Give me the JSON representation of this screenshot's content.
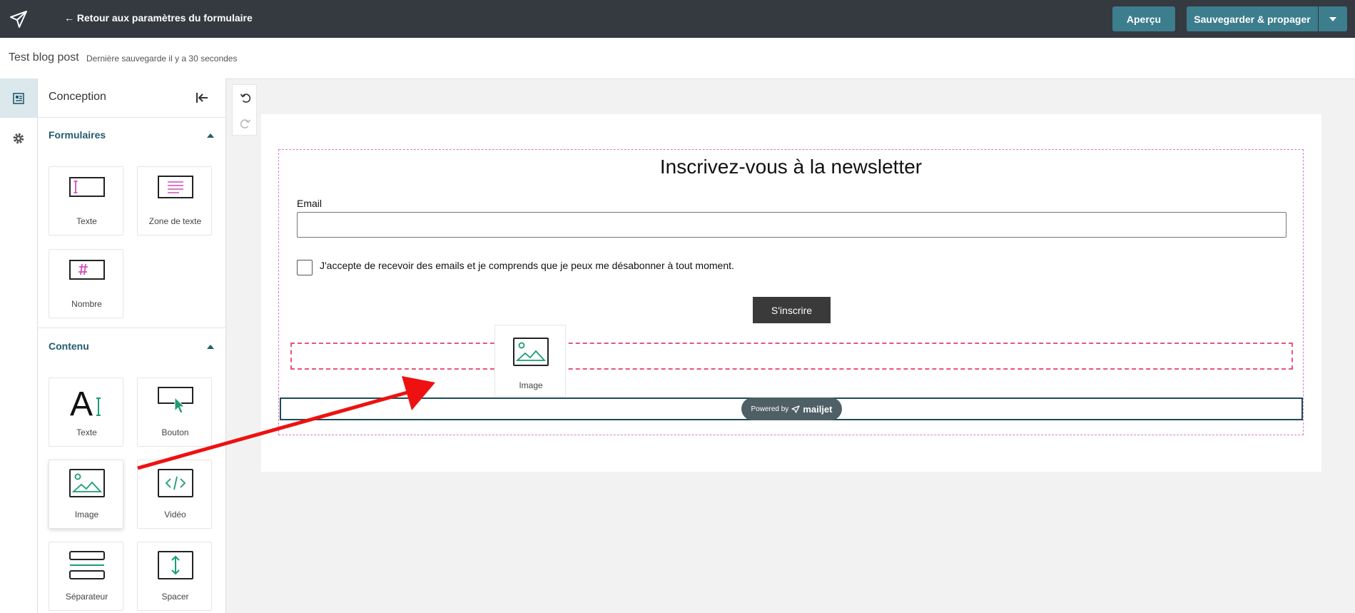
{
  "topbar": {
    "back_label": "← Retour aux paramètres du formulaire",
    "preview_label": "Aperçu",
    "save_label": "Sauvegarder & propager"
  },
  "titlebar": {
    "form_name": "Test blog post",
    "save_status": "Dernière sauvegarde il y a 30 secondes"
  },
  "panel": {
    "title": "Conception",
    "sections": [
      {
        "title": "Formulaires",
        "items": [
          {
            "label": "Texte",
            "icon": "text-field-icon"
          },
          {
            "label": "Zone de texte",
            "icon": "textarea-icon"
          },
          {
            "label": "Nombre",
            "icon": "number-field-icon"
          }
        ]
      },
      {
        "title": "Contenu",
        "items": [
          {
            "label": "Texte",
            "icon": "text-block-icon"
          },
          {
            "label": "Bouton",
            "icon": "button-block-icon"
          },
          {
            "label": "Image",
            "icon": "image-icon"
          },
          {
            "label": "Vidéo",
            "icon": "video-icon"
          },
          {
            "label": "Séparateur",
            "icon": "separator-icon"
          },
          {
            "label": "Spacer",
            "icon": "spacer-icon"
          }
        ]
      }
    ]
  },
  "form": {
    "heading": "Inscrivez-vous à la newsletter",
    "email_label": "Email",
    "email_value": "",
    "consent_text": "J'accepte de recevoir des emails et je comprends que je peux me désabonner à tout moment.",
    "consent_checked": false,
    "submit_label": "S'inscrire",
    "powered_by": "Powered by",
    "brand": "mailjet"
  },
  "drag_ghost": {
    "label": "Image",
    "icon": "image-icon"
  },
  "colors": {
    "topbar_bg": "#343a40",
    "primary_button": "#3c7d8e",
    "section_title": "#245b6e",
    "accent_pink": "#d24dbd",
    "accent_green": "#1b9e6e",
    "dropzone_border": "#e8557a",
    "annotation_arrow": "#ee1111"
  }
}
